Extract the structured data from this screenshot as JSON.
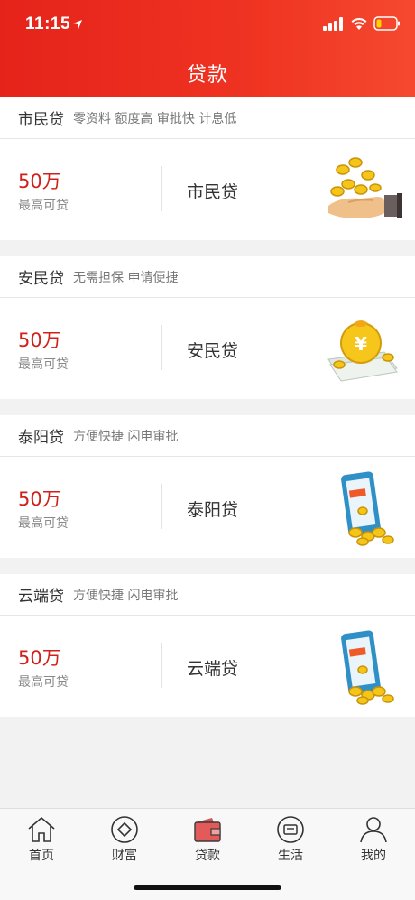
{
  "status": {
    "time": "11:15"
  },
  "header": {
    "title": "贷款"
  },
  "loans": [
    {
      "title": "市民贷",
      "tags": "零资料 额度高 审批快 计息低",
      "amount": "50万",
      "amount_label": "最高可贷",
      "name": "市民贷",
      "illustration": "coins-hand-icon"
    },
    {
      "title": "安民贷",
      "tags": "无需担保 申请便捷",
      "amount": "50万",
      "amount_label": "最高可贷",
      "name": "安民贷",
      "illustration": "money-bag-icon"
    },
    {
      "title": "泰阳贷",
      "tags": "方便快捷 闪电审批",
      "amount": "50万",
      "amount_label": "最高可贷",
      "name": "泰阳贷",
      "illustration": "phone-coins-icon"
    },
    {
      "title": "云端贷",
      "tags": "方便快捷 闪电审批",
      "amount": "50万",
      "amount_label": "最高可贷",
      "name": "云端贷",
      "illustration": "phone-coins-icon"
    }
  ],
  "tabs": [
    {
      "label": "首页",
      "icon": "home-icon"
    },
    {
      "label": "财富",
      "icon": "wealth-icon"
    },
    {
      "label": "贷款",
      "icon": "wallet-icon",
      "active": true
    },
    {
      "label": "生活",
      "icon": "life-icon"
    },
    {
      "label": "我的",
      "icon": "profile-icon"
    }
  ],
  "colors": {
    "brand": "#e5231a",
    "amount": "#d0201a"
  }
}
